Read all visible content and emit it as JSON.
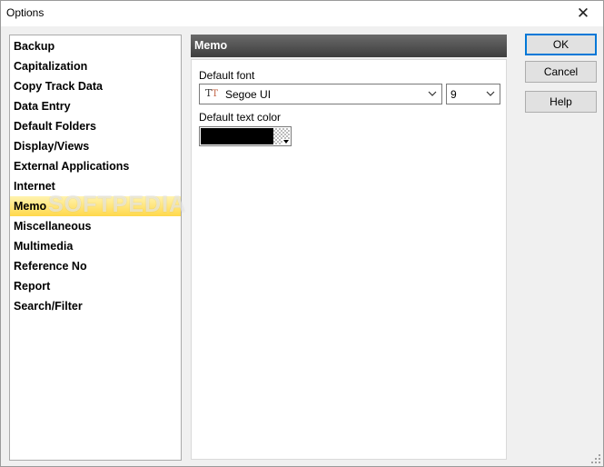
{
  "window": {
    "title": "Options",
    "close_glyph": "✕"
  },
  "nav": {
    "items": [
      {
        "label": "Backup",
        "selected": false
      },
      {
        "label": "Capitalization",
        "selected": false
      },
      {
        "label": "Copy Track Data",
        "selected": false
      },
      {
        "label": "Data Entry",
        "selected": false
      },
      {
        "label": "Default Folders",
        "selected": false
      },
      {
        "label": "Display/Views",
        "selected": false
      },
      {
        "label": "External Applications",
        "selected": false
      },
      {
        "label": "Internet",
        "selected": false
      },
      {
        "label": "Memo",
        "selected": true
      },
      {
        "label": "Miscellaneous",
        "selected": false
      },
      {
        "label": "Multimedia",
        "selected": false
      },
      {
        "label": "Reference No",
        "selected": false
      },
      {
        "label": "Report",
        "selected": false
      },
      {
        "label": "Search/Filter",
        "selected": false
      }
    ],
    "watermark": "SOFTPEDIA"
  },
  "panel": {
    "title": "Memo",
    "default_font_label": "Default font",
    "font_name": "Segoe UI",
    "font_icon": "truetype-font-icon",
    "font_size": "9",
    "default_text_color_label": "Default text color",
    "text_color": "#000000"
  },
  "buttons": {
    "ok": "OK",
    "cancel": "Cancel",
    "help": "Help"
  },
  "colors": {
    "selection_gradient_top": "#fff3b0",
    "selection_gradient_bottom": "#ffd84a",
    "header_dark": "#3e3e3e",
    "default_button_border": "#0078d7"
  }
}
